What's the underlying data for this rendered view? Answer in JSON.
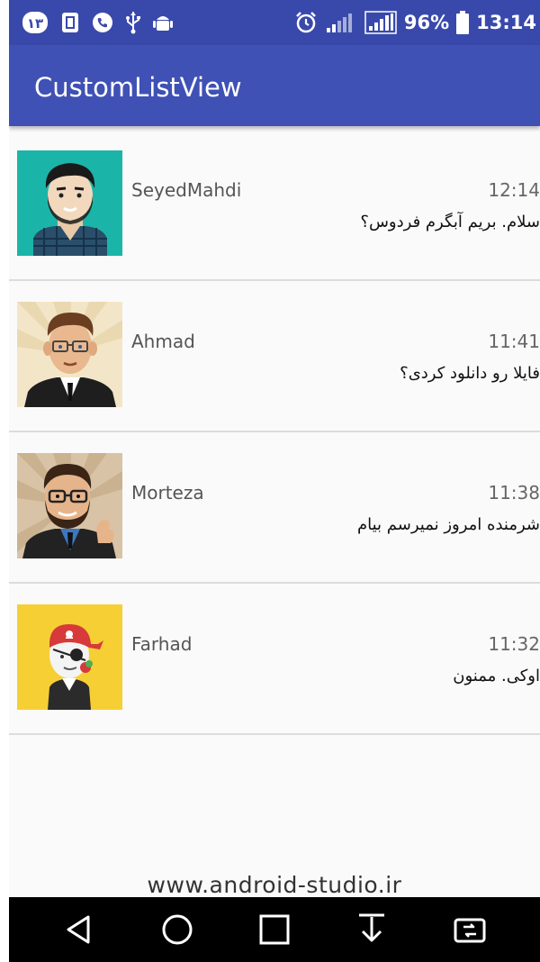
{
  "status_bar": {
    "notification_badge": "۱۳",
    "battery": "96%",
    "time": "13:14"
  },
  "app_bar": {
    "title": "CustomListView"
  },
  "contacts": [
    {
      "name": "SeyedMahdi",
      "time": "12:14",
      "message": "سلام. بریم آبگرم فردوس؟",
      "avatar_bg": "#1ab5a8"
    },
    {
      "name": "Ahmad",
      "time": "11:41",
      "message": "فایلا رو دانلود کردی؟",
      "avatar_bg": "#f3e6c8"
    },
    {
      "name": "Morteza",
      "time": "11:38",
      "message": "شرمنده امروز نمیرسم بیام",
      "avatar_bg": "#d8c3a6"
    },
    {
      "name": "Farhad",
      "time": "11:32",
      "message": "اوکی. ممنون",
      "avatar_bg": "#f6cf35"
    }
  ],
  "watermark": "www.android-studio.ir",
  "colors": {
    "status_bar": "#3949ab",
    "app_bar": "#3f51b5",
    "background": "#fafafa",
    "divider": "#dcdcdc"
  },
  "nav_bar": {
    "icons": [
      "back-icon",
      "home-icon",
      "recents-icon",
      "notification-pull-icon",
      "screen-switch-icon"
    ]
  }
}
